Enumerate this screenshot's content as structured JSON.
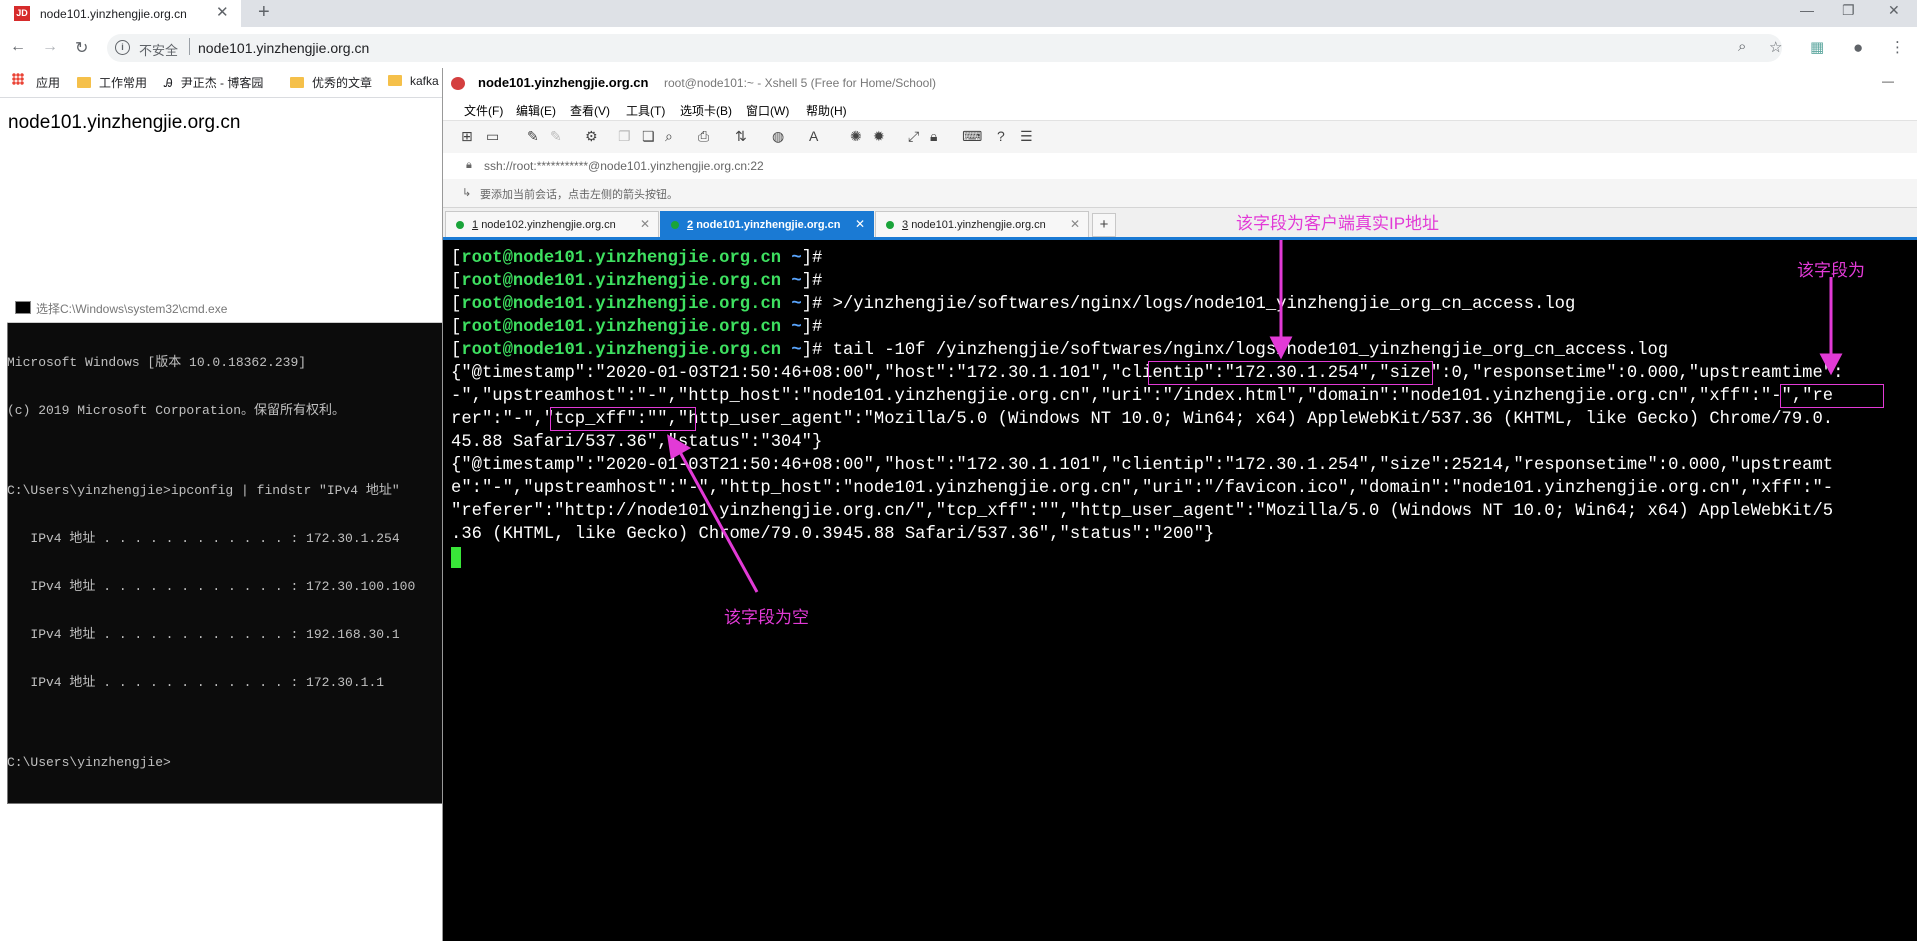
{
  "browser": {
    "tab_title": "node101.yinzhengjie.org.cn",
    "favicon_text": "JD",
    "insecure_label": "不安全",
    "url": "node101.yinzhengjie.org.cn",
    "bookmarks": [
      "应用",
      "工作常用",
      "尹正杰 - 博客园",
      "优秀的文章",
      "kafka"
    ],
    "page_heading": "node101.yinzhengjie.org.cn"
  },
  "cmd": {
    "title": "选择C:\\Windows\\system32\\cmd.exe",
    "lines": [
      "Microsoft Windows [版本 10.0.18362.239]",
      "(c) 2019 Microsoft Corporation。保留所有权利。",
      "",
      "C:\\Users\\yinzhengjie>ipconfig | findstr \"IPv4 地址\"",
      "   IPv4 地址 . . . . . . . . . . . . : 172.30.1.254",
      "   IPv4 地址 . . . . . . . . . . . . : 172.30.100.100",
      "   IPv4 地址 . . . . . . . . . . . . : 192.168.30.1",
      "   IPv4 地址 . . . . . . . . . . . . : 172.30.1.1",
      "",
      "C:\\Users\\yinzhengjie>"
    ]
  },
  "xshell": {
    "title_main": "node101.yinzhengjie.org.cn",
    "title_sub": "root@node101:~ - Xshell 5 (Free for Home/School)",
    "menu": [
      "文件(F)",
      "编辑(E)",
      "查看(V)",
      "工具(T)",
      "选项卡(B)",
      "窗口(W)",
      "帮助(H)"
    ],
    "address": "ssh://root:***********@node101.yinzhengjie.org.cn:22",
    "hint": "要添加当前会话，点击左侧的箭头按钮。",
    "tabs": [
      {
        "num": "1",
        "label": "node102.yinzhengjie.org.cn"
      },
      {
        "num": "2",
        "label": "node101.yinzhengjie.org.cn"
      },
      {
        "num": "3",
        "label": "node101.yinzhengjie.org.cn"
      }
    ],
    "prompt": {
      "open": "[",
      "host": "root@node101.yinzhengjie.org.cn",
      "tilde": " ~",
      "close": "]#"
    },
    "commands": [
      "",
      "",
      " >/yinzhengjie/softwares/nginx/logs/node101_yinzhengjie_org_cn_access.log",
      "",
      " tail -10f /yinzhengjie/softwares/nginx/logs/node101_yinzhengjie_org_cn_access.log"
    ],
    "output": [
      "{\"@timestamp\":\"2020-01-03T21:50:46+08:00\",\"host\":\"172.30.1.101\",\"clientip\":\"172.30.1.254\",\"size\":0,\"responsetime\":0.000,\"upstreamtime\":",
      "-\",\"upstreamhost\":\"-\",\"http_host\":\"node101.yinzhengjie.org.cn\",\"uri\":\"/index.html\",\"domain\":\"node101.yinzhengjie.org.cn\",\"xff\":\"-\",\"re",
      "rer\":\"-\",\"tcp_xff\":\"\",\"http_user_agent\":\"Mozilla/5.0 (Windows NT 10.0; Win64; x64) AppleWebKit/537.36 (KHTML, like Gecko) Chrome/79.0.",
      "45.88 Safari/537.36\",\"status\":\"304\"}",
      "{\"@timestamp\":\"2020-01-03T21:50:46+08:00\",\"host\":\"172.30.1.101\",\"clientip\":\"172.30.1.254\",\"size\":25214,\"responsetime\":0.000,\"upstreamt",
      "e\":\"-\",\"upstreamhost\":\"-\",\"http_host\":\"node101.yinzhengjie.org.cn\",\"uri\":\"/favicon.ico\",\"domain\":\"node101.yinzhengjie.org.cn\",\"xff\":\"-",
      "\"referer\":\"http://node101.yinzhengjie.org.cn/\",\"tcp_xff\":\"\",\"http_user_agent\":\"Mozilla/5.0 (Windows NT 10.0; Win64; x64) AppleWebKit/5",
      ".36 (KHTML, like Gecko) Chrome/79.0.3945.88 Safari/537.36\",\"status\":\"200\"}"
    ]
  },
  "annotations": {
    "client_ip_note": "该字段为客户端真实IP地址",
    "xff_note": "该字段为",
    "tcp_xff_note": "该字段为空",
    "accent_color": "#e23ad6"
  }
}
